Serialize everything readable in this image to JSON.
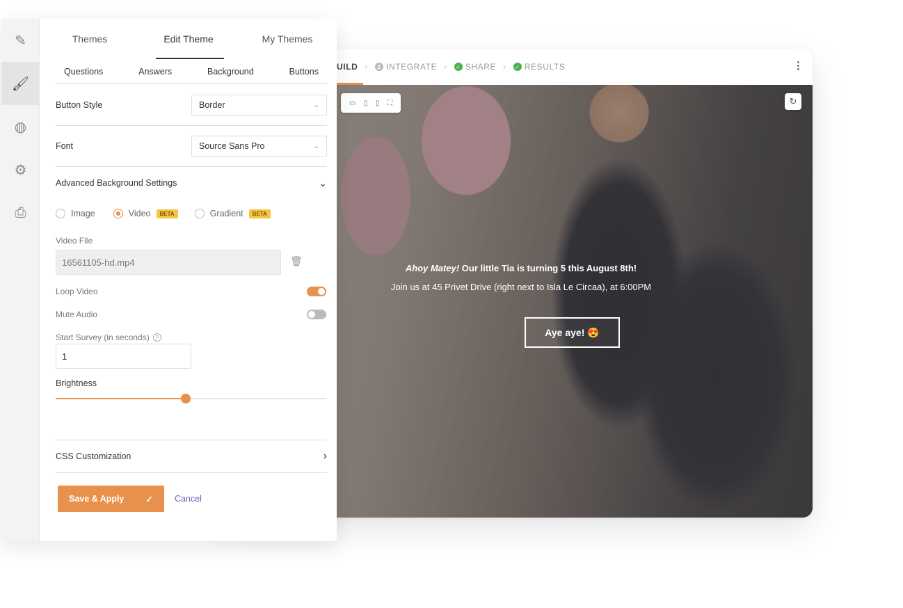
{
  "preview": {
    "steps": [
      {
        "label": "UILD",
        "state": "active"
      },
      {
        "label": "INTEGRATE",
        "state": "numbered",
        "num": "2"
      },
      {
        "label": "SHARE",
        "state": "done"
      },
      {
        "label": "RESULTS",
        "state": "done"
      }
    ],
    "invite_em": "Ahoy Matey!",
    "invite_line1_rest": " Our little Tia is turning 5 this August 8th!",
    "invite_line2": "Join us at 45 Privet Drive (right next to Isla Le Circaa), at 6:00PM",
    "cta_label": "Aye aye! 😍"
  },
  "editor": {
    "top_tabs": [
      "Themes",
      "Edit Theme",
      "My Themes"
    ],
    "sub_tabs": [
      "Questions",
      "Answers",
      "Background",
      "Buttons"
    ],
    "button_style": {
      "label": "Button Style",
      "value": "Border"
    },
    "font": {
      "label": "Font",
      "value": "Source Sans Pro"
    },
    "advanced_bg": {
      "label": "Advanced Background Settings"
    },
    "bg_types": [
      {
        "label": "Image",
        "selected": false,
        "beta": ""
      },
      {
        "label": "Video",
        "selected": true,
        "beta": "BETA"
      },
      {
        "label": "Gradient",
        "selected": false,
        "beta": "BETA"
      }
    ],
    "video_file": {
      "label": "Video File",
      "value": "16561105-hd.mp4"
    },
    "loop_video": {
      "label": "Loop Video",
      "on": true
    },
    "mute_audio": {
      "label": "Mute Audio",
      "on": false
    },
    "start_survey": {
      "label": "Start Survey (in seconds)",
      "value": "1"
    },
    "brightness": {
      "label": "Brightness",
      "value": 0.48
    },
    "css_custom": {
      "label": "CSS Customization"
    },
    "save_label": "Save & Apply",
    "cancel_label": "Cancel"
  },
  "colors": {
    "accent": "#e8914c",
    "success": "#4caf50",
    "link": "#7e57c2"
  }
}
